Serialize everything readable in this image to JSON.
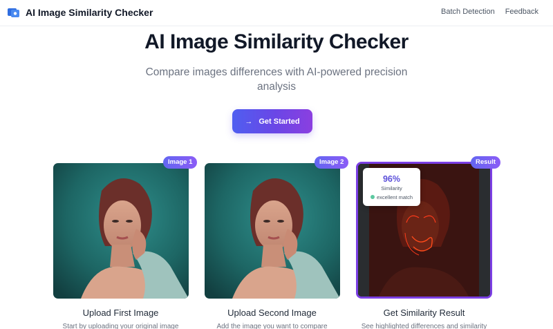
{
  "header": {
    "brand": "AI Image Similarity Checker",
    "nav": [
      "Batch Detection",
      "Feedback"
    ]
  },
  "hero": {
    "title": "AI Image Similarity Checker",
    "subtitle": "Compare images differences with AI-powered precision analysis",
    "cta_label": "Get Started",
    "cta_icon": "arrow-right-icon"
  },
  "cards": [
    {
      "badge": "Image 1",
      "title": "Upload First Image",
      "desc": "Start by uploading your original image"
    },
    {
      "badge": "Image 2",
      "title": "Upload Second Image",
      "desc": "Add the image you want to compare"
    },
    {
      "badge": "Result",
      "title": "Get Similarity Result",
      "desc": "See highlighted differences and similarity"
    }
  ],
  "result": {
    "similarity_value": "96%",
    "similarity_label": "Similarity",
    "status": "excellent match"
  },
  "colors": {
    "accent_start": "#4f5ef0",
    "accent_end": "#8b3fe0",
    "status_dot": "#5cc8a0"
  }
}
